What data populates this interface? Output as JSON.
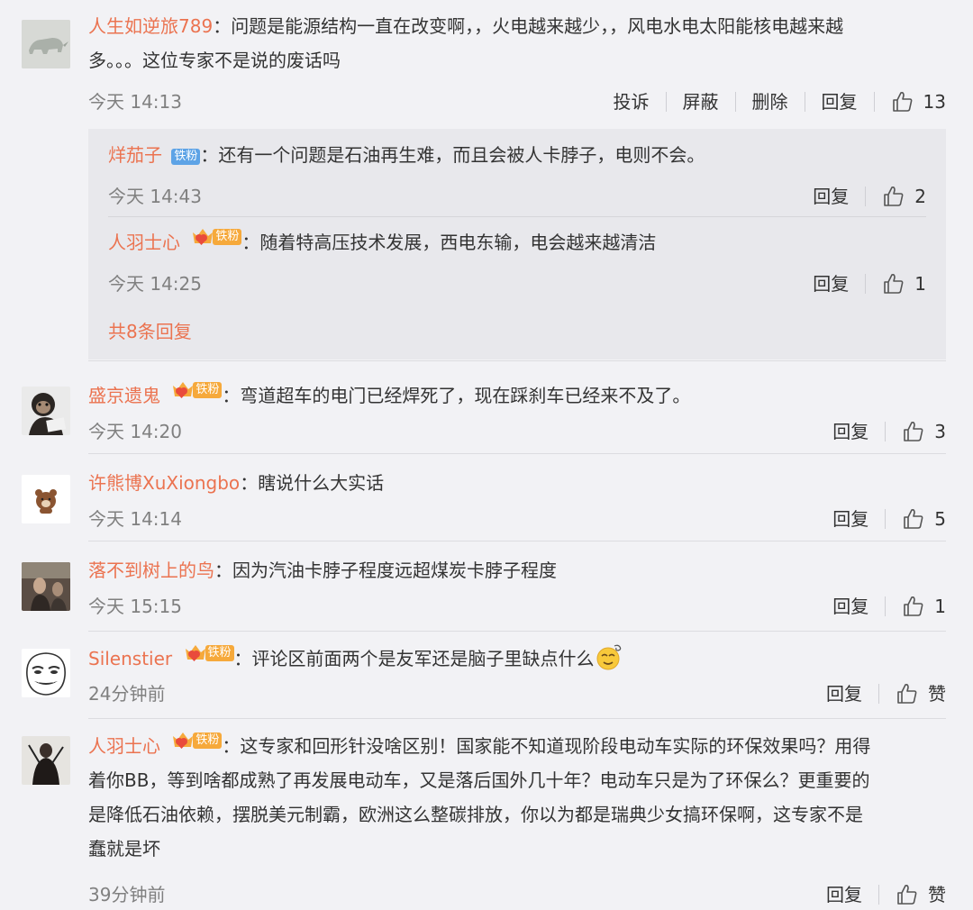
{
  "labels": {
    "report": "投诉",
    "block": "屏蔽",
    "delete": "删除",
    "reply": "回复",
    "like_text": "赞",
    "colon": "："
  },
  "c1": {
    "user": "人生如逆旅789",
    "line1": "问题是能源结构一直在改变啊，，火电越来越少，，风电水电太阳能核电越来越",
    "line2": "多。。。这位专家不是说的废话吗",
    "time": "今天 14:13",
    "likes": "13",
    "avatar_icon": "rhino-image-icon"
  },
  "r1": {
    "user": "烊茄子",
    "badge": "铁粉",
    "text": "还有一个问题是石油再生难，而且会被人卡脖子，电则不会。",
    "time": "今天 14:43",
    "likes": "2"
  },
  "r2": {
    "user": "人羽士心",
    "badge": "铁粉",
    "text": "随着特高压技术发展，西电东输，电会越来越清洁",
    "time": "今天 14:25",
    "likes": "1"
  },
  "more_replies": "共8条回复",
  "c2": {
    "user": "盛京遗鬼",
    "badge": "铁粉",
    "text": "弯道超车的电门已经焊死了，现在踩刹车已经来不及了。",
    "time": "今天 14:20",
    "likes": "3",
    "avatar_icon": "monkey-image-icon"
  },
  "c3": {
    "user": "许熊博XuXiongbo",
    "text": "瞎说什么大实话",
    "time": "今天 14:14",
    "likes": "5",
    "avatar_icon": "brown-bear-icon"
  },
  "c4": {
    "user": "落不到树上的鸟",
    "text": "因为汽油卡脖子程度远超煤炭卡脖子程度",
    "time": "今天 15:15",
    "likes": "1",
    "avatar_icon": "portrait-image-icon"
  },
  "c5": {
    "user": "Silenstier",
    "badge": "铁粉",
    "text": "评论区前面两个是友军还是脑子里缺点什么",
    "time": "24分钟前",
    "avatar_icon": "meme-face-icon",
    "emoji_icon": "dizzy-face-emoji-icon"
  },
  "c6": {
    "user": "人羽士心",
    "badge": "铁粉",
    "line1": "这专家和回形针没啥区别！国家能不知道现阶段电动车实际的环保效果吗？用得",
    "line2": "着你BB，等到啥都成熟了再发展电动车，又是落后国外几十年？电动车只是为了环保么？更重要的",
    "line3": "是降低石油依赖，摆脱美元制霸，欧洲这么整碳排放，你以为都是瑞典少女搞环保啊，这专家不是",
    "line4": "蠢就是坏",
    "time": "39分钟前",
    "avatar_icon": "dark-figure-icon"
  },
  "colors": {
    "username": "#eb7350",
    "badge_blue": "#5da3e6",
    "badge_orange": "#f6a93b",
    "crown_red": "#e94b3c",
    "reply_bg": "#e8e8ec",
    "page_bg": "#f2f2f5"
  }
}
